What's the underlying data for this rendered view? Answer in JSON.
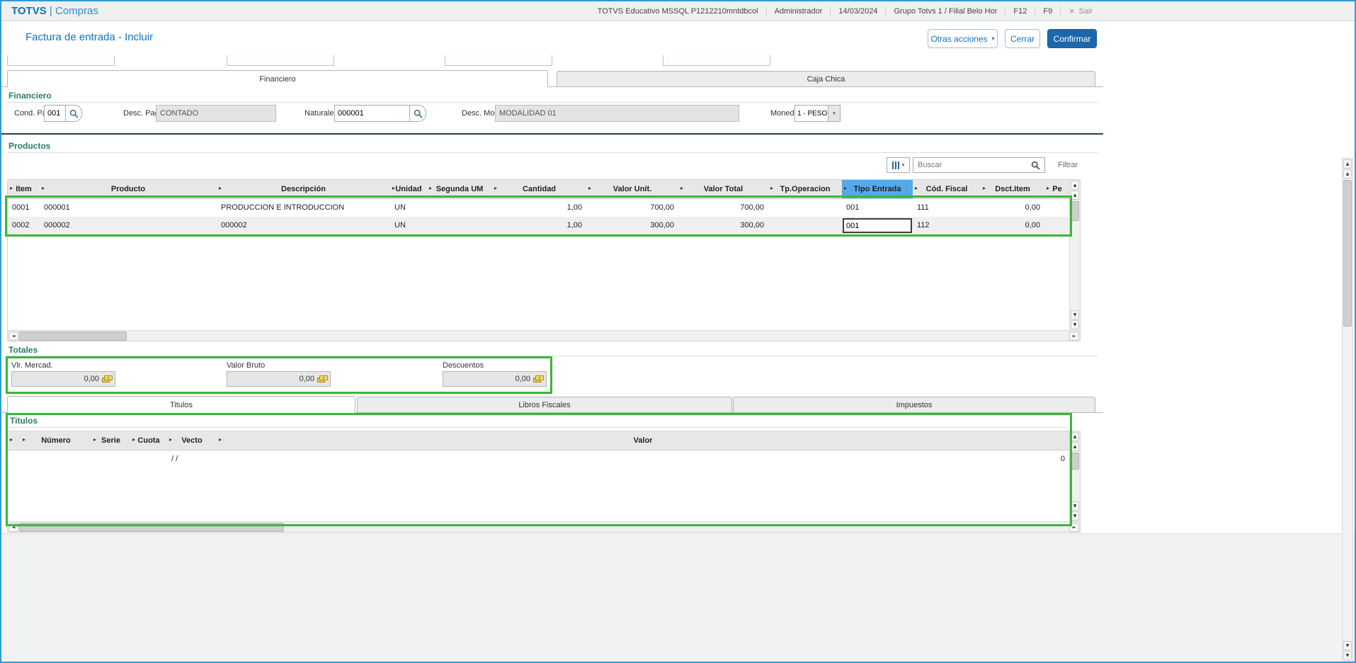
{
  "colors": {
    "brand_blue": "#1272ba",
    "confirm_button": "#1b67ad",
    "selected_column_highlight": "#55a9e8",
    "annotation_green": "#3cb53c",
    "section_title_teal": "#267b68"
  },
  "icons": {
    "up": "▲",
    "down": "▼",
    "left": "◄",
    "right": "►",
    "tri": "▸",
    "dropdown": "▾",
    "chevron_down": "▾",
    "close": "×"
  },
  "topbar": {
    "brand_primary": "TOTVS",
    "brand_secondary": "| Compras",
    "environment": "TOTVS Educativo MSSQL P1212210mntdbcol",
    "user": "Administrador",
    "date": "14/03/2024",
    "branch": "Grupo Totvs 1 / Filial Belo Hor",
    "shortcut_f12": "F12",
    "shortcut_f9": "F9",
    "exit_label": "Sair"
  },
  "header": {
    "title": "Factura de entrada - Incluir",
    "other_actions_label": "Otras acciones",
    "close_label": "Cerrar",
    "confirm_label": "Confirmar"
  },
  "tabs_top": [
    {
      "label": "Financiero",
      "active": true
    },
    {
      "label": "Caja Chica",
      "active": false
    }
  ],
  "financiero": {
    "section_title": "Financiero",
    "cond_pago": {
      "label": "Cond. Pago",
      "value": "001"
    },
    "desc_pago": {
      "label": "Desc. Pago",
      "value": "CONTADO"
    },
    "naturaleza": {
      "label": "Naturaleza",
      "value": "000001"
    },
    "desc_mod": {
      "label": "Desc. Mod.",
      "value": "MODALIDAD 01"
    },
    "moneda": {
      "label": "Moneda",
      "value": "1 - PESO"
    }
  },
  "productos": {
    "section_title": "Productos",
    "search_placeholder": "Buscar",
    "filter_label": "Filtrar",
    "selected_column": "Tipo Entrada",
    "columns": [
      "Item",
      "Producto",
      "Descripción",
      "Unidad",
      "Segunda UM",
      "Cantidad",
      "Valor Unit.",
      "Valor Total",
      "Tp.Operacion",
      "Tipo Entrada",
      "Cód. Fiscal",
      "Dsct.Item",
      "Pe"
    ],
    "rows": [
      [
        "0001",
        "000001",
        "PRODUCCION E INTRODUCCION",
        "UN",
        "",
        "1,00",
        "700,00",
        "700,00",
        "",
        "001",
        "111",
        "0,00",
        ""
      ],
      [
        "0002",
        "000002",
        "000002",
        "UN",
        "",
        "1,00",
        "300,00",
        "300,00",
        "",
        "001",
        "112",
        "0,00",
        ""
      ]
    ]
  },
  "totales": {
    "section_title": "Totales",
    "fields": [
      {
        "label": "Vlr. Mercad.",
        "value": "0,00"
      },
      {
        "label": "Valor Bruto",
        "value": "0,00"
      },
      {
        "label": "Descuentos",
        "value": "0,00"
      }
    ]
  },
  "tabs_bottom": [
    {
      "label": "Titulos",
      "active": true
    },
    {
      "label": "Libros Fiscales",
      "active": false
    },
    {
      "label": "Impuestos",
      "active": false
    }
  ],
  "titulos": {
    "section_title": "Titulos",
    "columns": [
      "Número",
      "Serie",
      "Cuota",
      "Vecto",
      "Valor"
    ],
    "rows": [
      {
        "numero": "",
        "serie": "",
        "cuota": "",
        "vecto": "/ /",
        "valor": "0"
      }
    ]
  }
}
